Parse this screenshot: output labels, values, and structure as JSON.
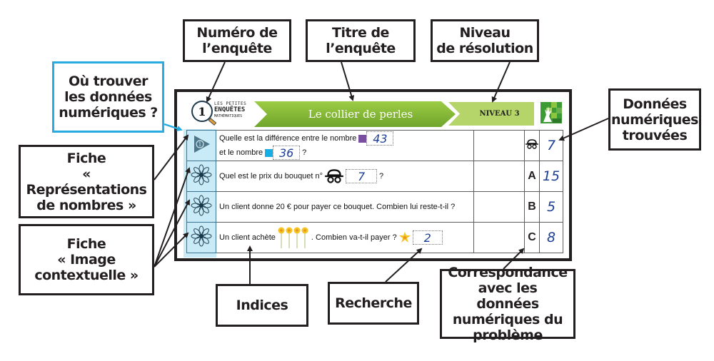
{
  "callouts": {
    "numero": "Numéro de\nl’enquête",
    "titre": "Titre de l’enquête",
    "niveau": "Niveau\nde résolution",
    "ou_trouver": "Où trouver\nles données\nnumériques ?",
    "fiche_representations": "Fiche\n« Représentations\nde nombres »",
    "fiche_image": "Fiche\n« Image\ncontextuelle »",
    "donnees_trouvees": "Données\nnumériques\ntrouvées",
    "indices": "Indices",
    "recherche": "Recherche",
    "correspondance": "Correspondance\navec les données\nnumériques du\nproblème"
  },
  "card": {
    "number": "1",
    "brand": {
      "line1": "LES PETITES",
      "line2": "ENQUÊTES",
      "line3": "MATHÉMATIQUES"
    },
    "title": "Le collier de perles",
    "level": "NIVEAU 3",
    "colors": {
      "banner_green": "#8dc63f",
      "level_green": "#b5d56a",
      "hint_blue": "#c9ebf8",
      "handwriting": "#1c3f94",
      "purple": "#7b4fa0",
      "cyan": "#17aee6"
    }
  },
  "rows": [
    {
      "hint_icon": "play-triangle-icon",
      "q_line1": "Quelle est la différence entre le nombre",
      "q_val1": "43",
      "q_line2": "et le nombre",
      "q_val2": "36",
      "q_end": "?",
      "key_icon": "detective-icon",
      "key": "",
      "value": "7"
    },
    {
      "hint_icon": "flower-icon",
      "q_text": "Quel est le prix du bouquet n°",
      "q_val": "7",
      "q_end": "?",
      "key": "A",
      "value": "15"
    },
    {
      "hint_icon": "flower-icon",
      "q_text": "Un client donne 20 € pour payer ce bouquet. Combien lui reste-t-il ?",
      "key": "B",
      "value": "5"
    },
    {
      "hint_icon": "flower-icon",
      "q_text": "Un client achète",
      "q_mid": ". Combien va-t-il payer ?",
      "q_val": "2",
      "key": "C",
      "value": "8"
    }
  ]
}
